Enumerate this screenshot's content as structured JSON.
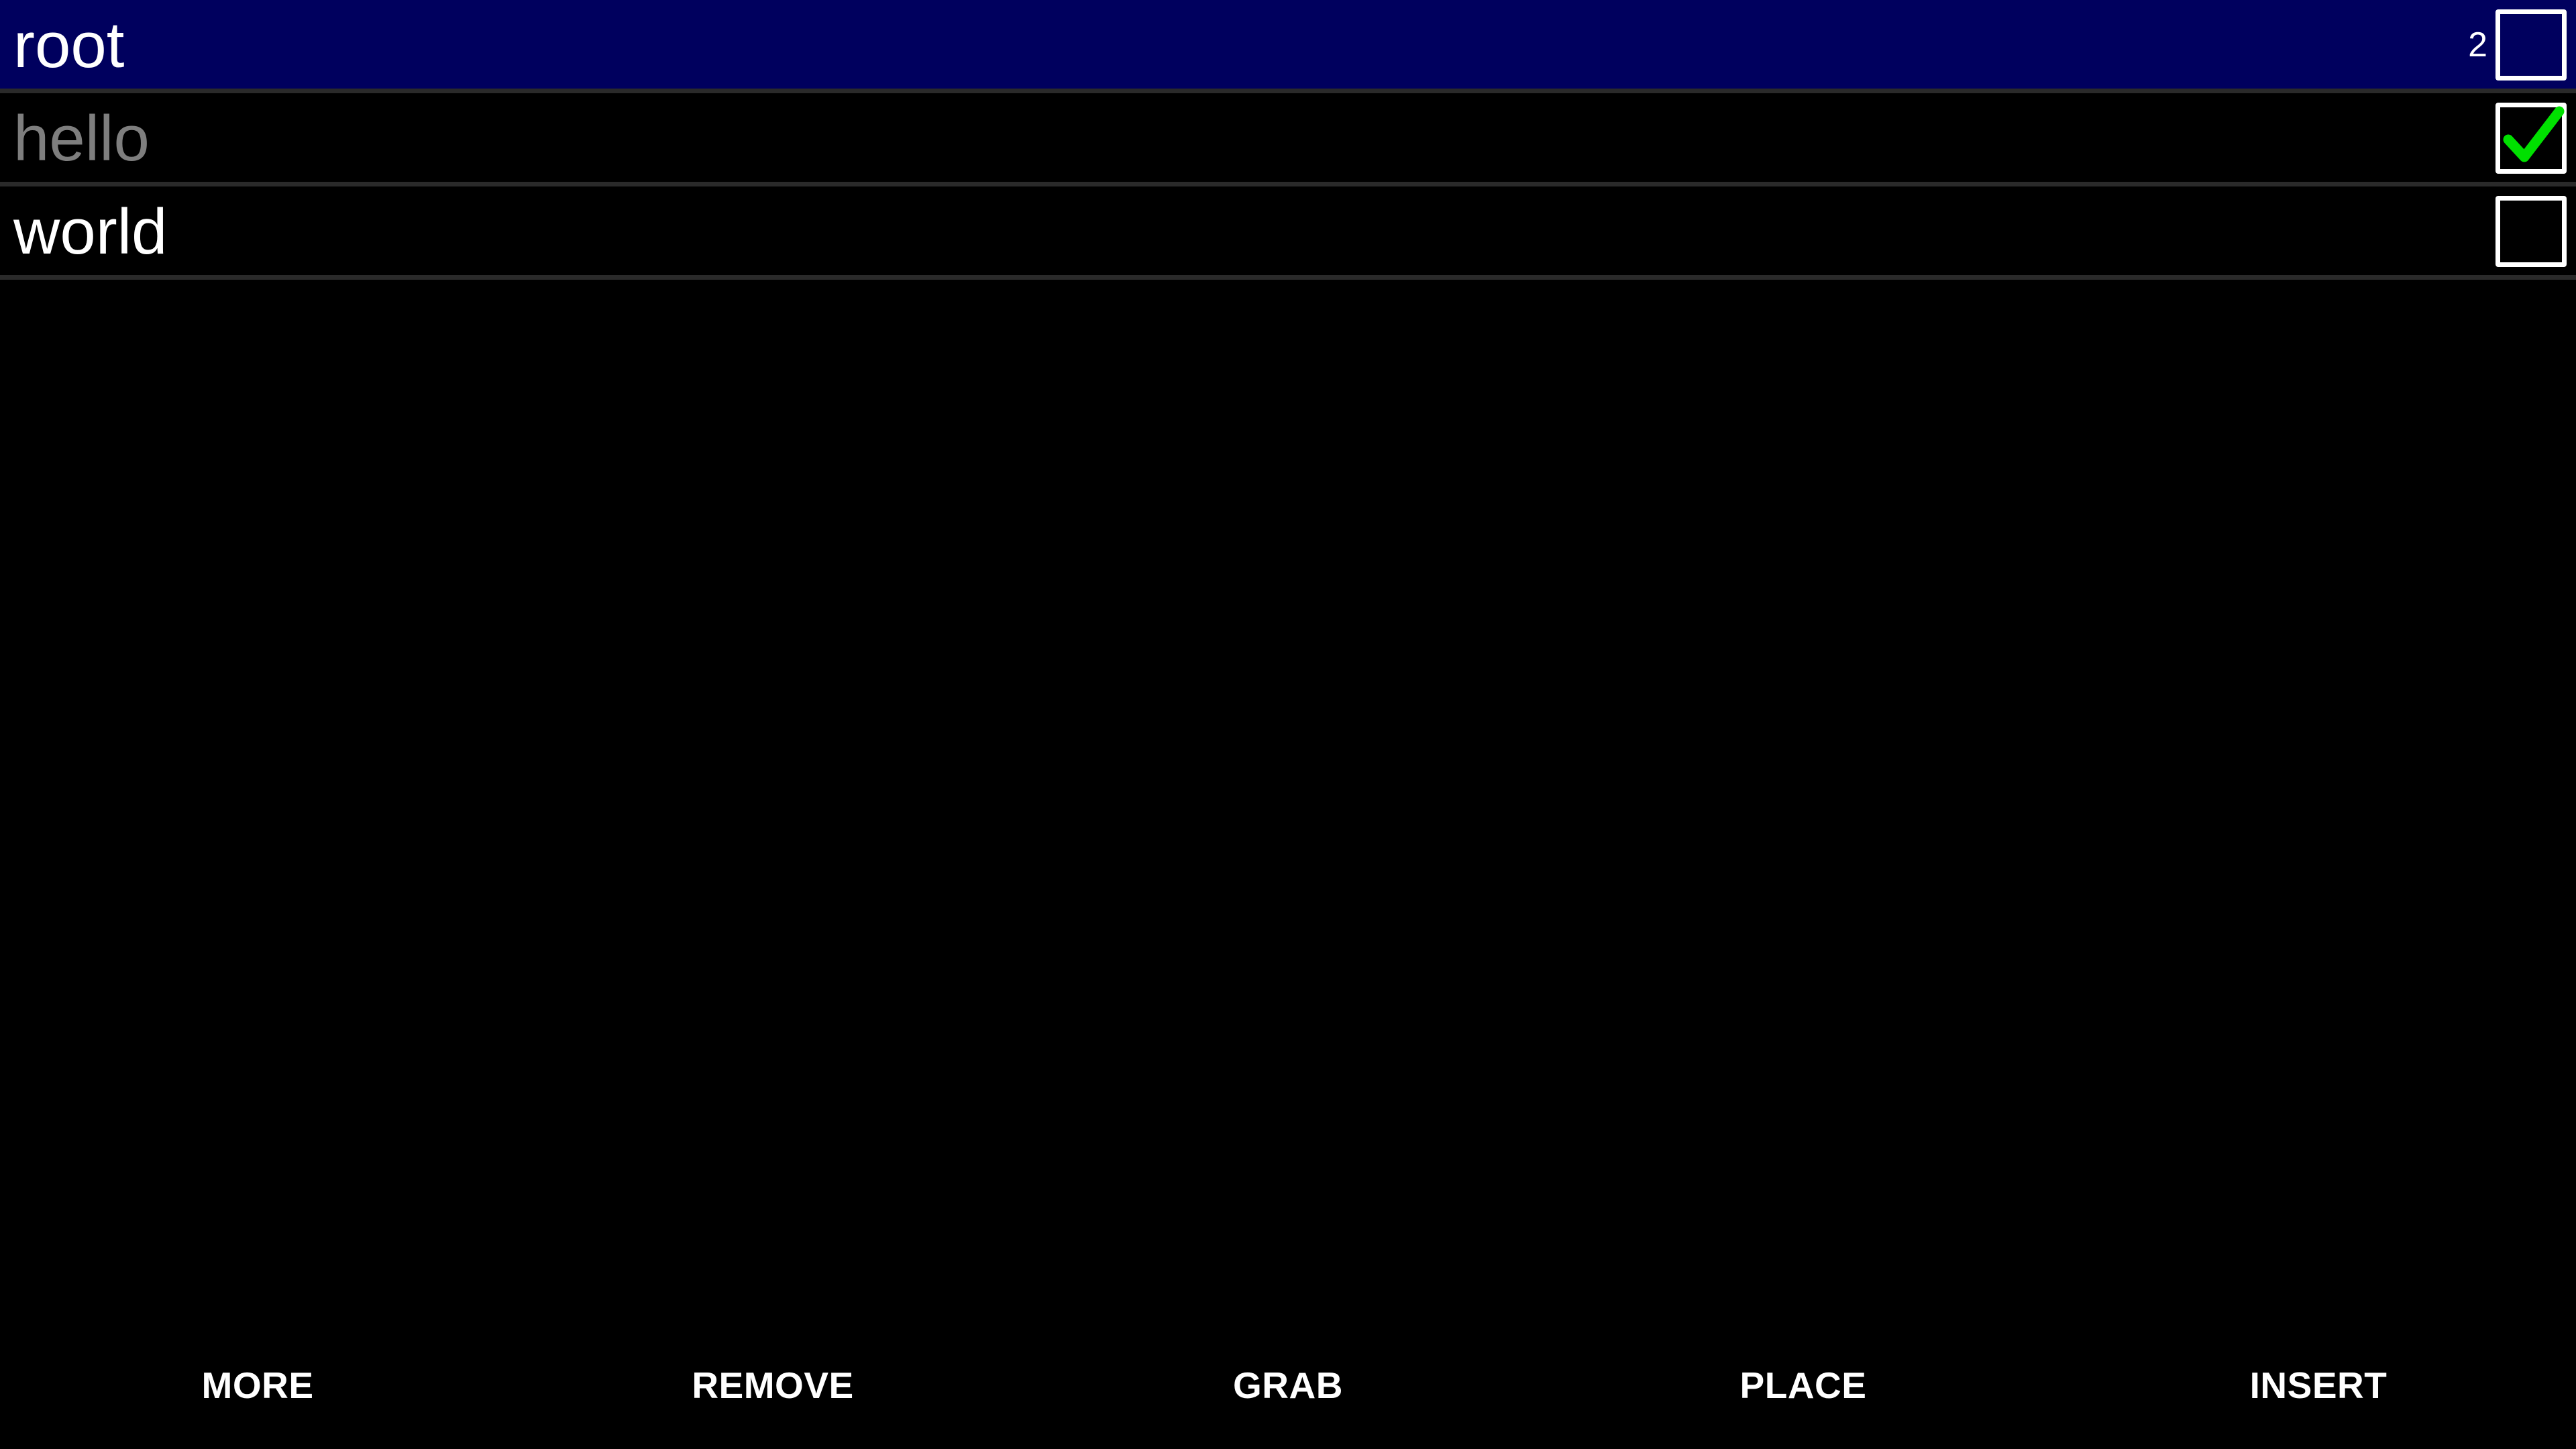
{
  "rows": [
    {
      "label": "root",
      "count": "2",
      "checked": false,
      "style": "selected"
    },
    {
      "label": "hello",
      "count": "",
      "checked": true,
      "style": "done"
    },
    {
      "label": "world",
      "count": "",
      "checked": false,
      "style": "normal"
    }
  ],
  "toolbar": {
    "more_label": "MORE",
    "remove_label": "REMOVE",
    "grab_label": "GRAB",
    "place_label": "PLACE",
    "insert_label": "INSERT"
  },
  "colors": {
    "background": "#000000",
    "selected_row": "#00005e",
    "done_text": "#7e7e7e",
    "checkmark": "#00e000",
    "divider": "#2a2a2a"
  },
  "icons": {
    "checkbox_checked": "checkmark-icon"
  }
}
